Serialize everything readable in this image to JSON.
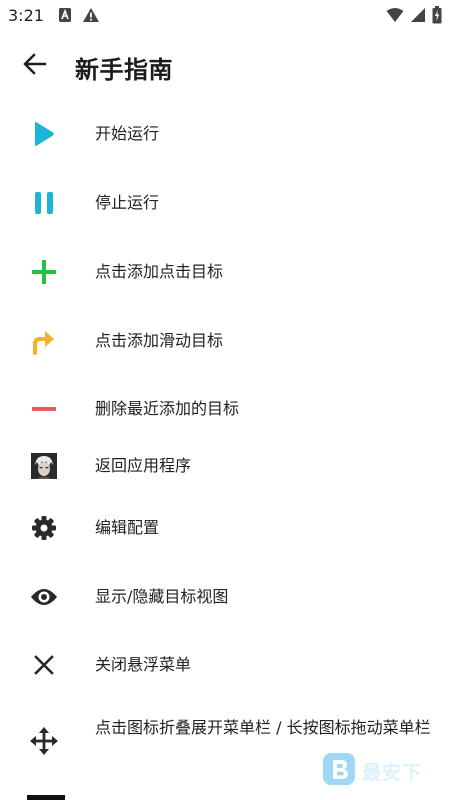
{
  "status_bar": {
    "time": "3:21",
    "left_icons": [
      "a-box-icon",
      "warning-icon"
    ],
    "right_icons": [
      "wifi-icon",
      "signal-icon",
      "battery-icon"
    ]
  },
  "app_bar": {
    "back_icon": "arrow-left-icon",
    "title": "新手指南"
  },
  "items": [
    {
      "icon": "play-icon",
      "color": "#1cb5d8",
      "label": "开始运行"
    },
    {
      "icon": "pause-icon",
      "color": "#1cb5d8",
      "label": "停止运行"
    },
    {
      "icon": "plus-icon",
      "color": "#22c244",
      "label": "点击添加点击目标"
    },
    {
      "icon": "swipe-arrow-icon",
      "color": "#f2b22c",
      "label": "点击添加滑动目标"
    },
    {
      "icon": "minus-icon",
      "color": "#ee5a5a",
      "label": "删除最近添加的目标"
    },
    {
      "icon": "app-avatar-icon",
      "color": "#2a2a2a",
      "label": "返回应用程序"
    },
    {
      "icon": "gear-icon",
      "color": "#2a2a2a",
      "label": "编辑配置"
    },
    {
      "icon": "eye-icon",
      "color": "#2a2a2a",
      "label": "显示/隐藏目标视图"
    },
    {
      "icon": "close-icon",
      "color": "#2a2a2a",
      "label": "关闭悬浮菜单"
    },
    {
      "icon": "move-arrows-icon",
      "color": "#2a2a2a",
      "label": "点击图标折叠展开菜单栏 / 长按图标拖动菜单栏"
    }
  ],
  "watermark": {
    "icon": "b-logo-icon",
    "text": "最安下"
  }
}
